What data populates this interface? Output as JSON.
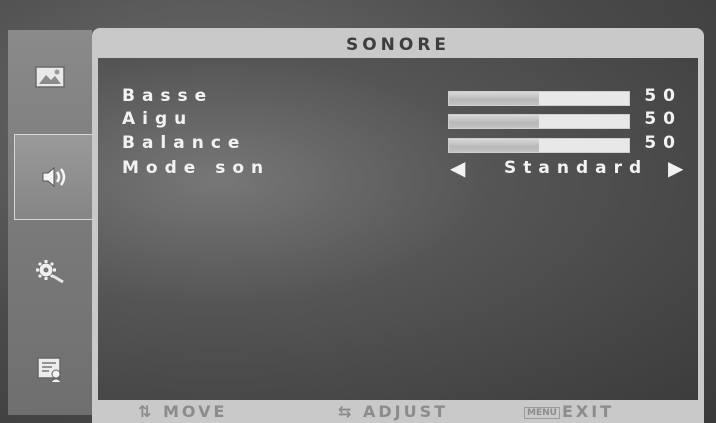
{
  "menu": {
    "title": "SONORE",
    "rows": [
      {
        "label": "Basse",
        "value": "50",
        "level": 50
      },
      {
        "label": "Aigu",
        "value": "50",
        "level": 50
      },
      {
        "label": "Balance",
        "value": "50",
        "level": 50
      }
    ],
    "mode": {
      "label": "Mode son",
      "value": "Standard"
    }
  },
  "sidebar": {
    "items": [
      {
        "icon": "picture-icon",
        "selected": false
      },
      {
        "icon": "speaker-icon",
        "selected": true
      },
      {
        "icon": "settings-icon",
        "selected": false
      },
      {
        "icon": "info-icon",
        "selected": false
      }
    ]
  },
  "footer": {
    "move": "MOVE",
    "adjust": "ADJUST",
    "menu_key": "MENU",
    "exit": "EXIT"
  },
  "colors": {
    "text": "#f2f2f2",
    "frame": "#c9c9c9",
    "footer_text": "#8c8c8c"
  }
}
